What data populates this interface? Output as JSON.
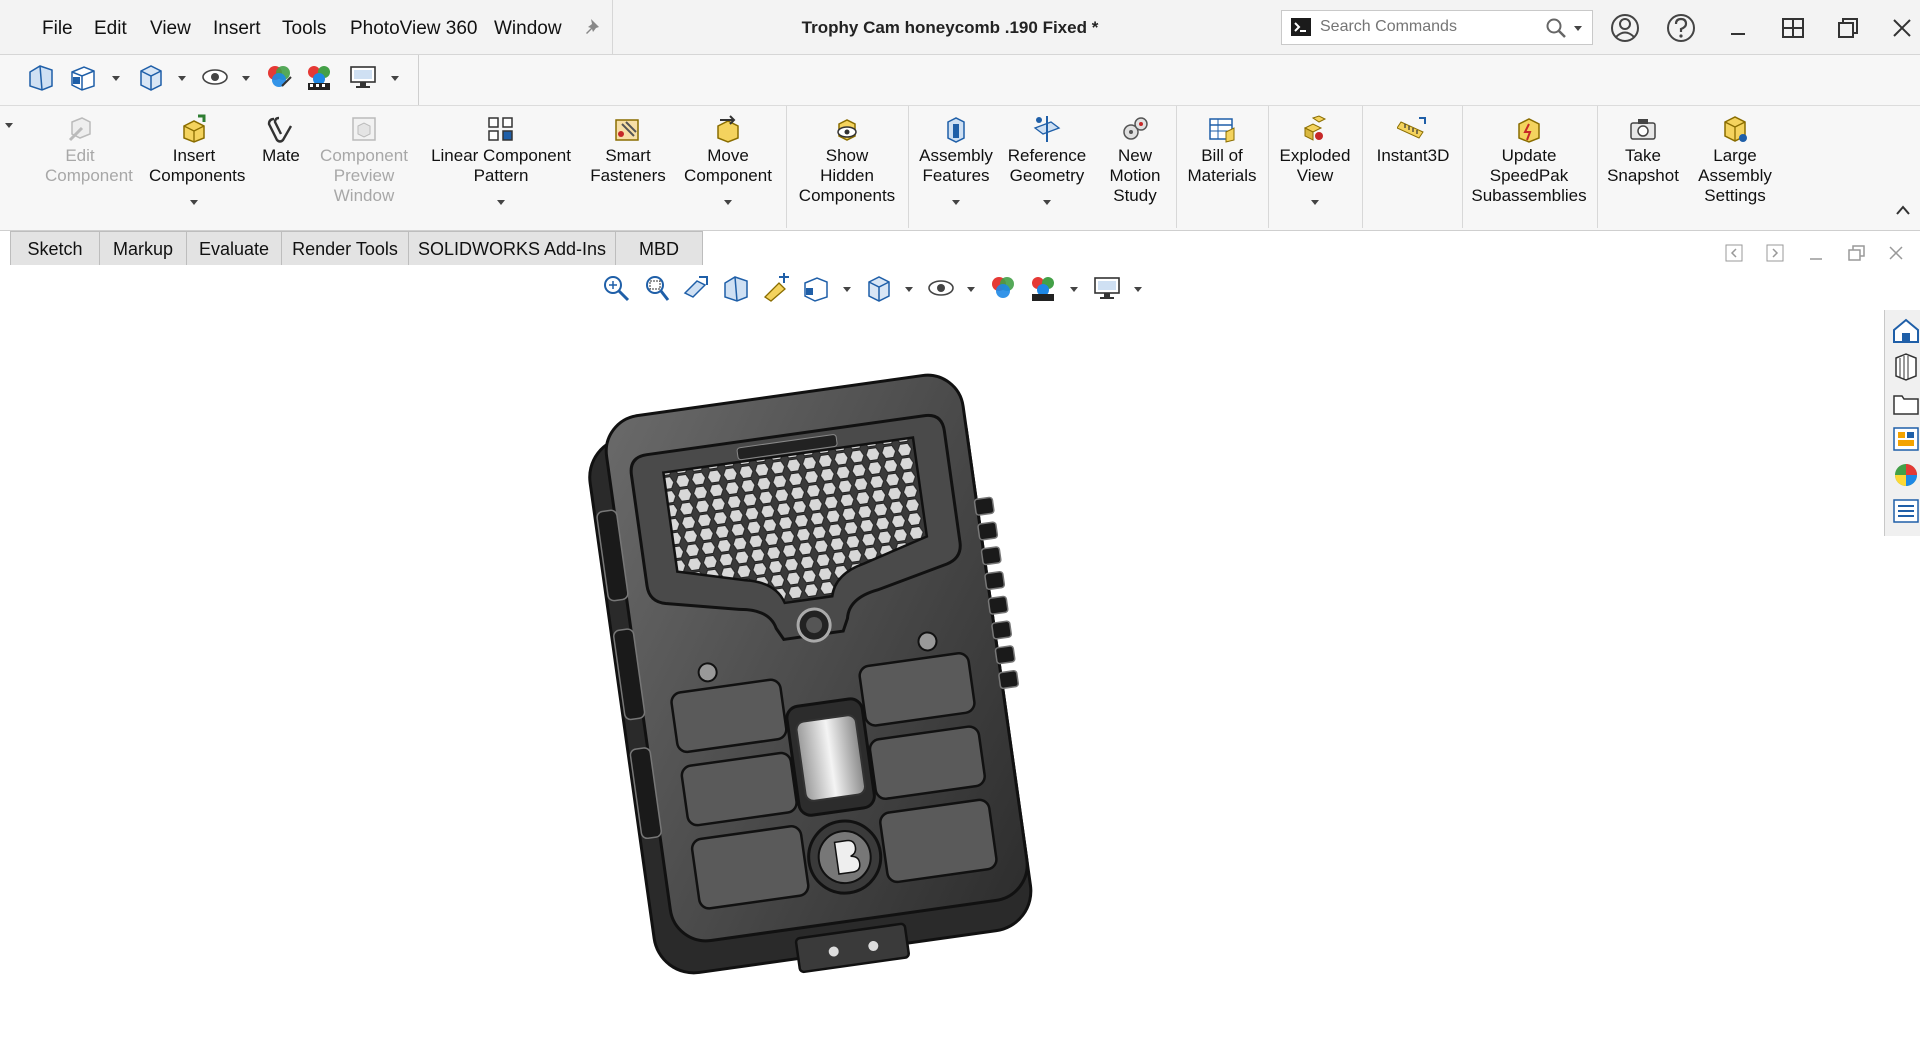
{
  "menu": {
    "file": "File",
    "edit": "Edit",
    "view": "View",
    "insert": "Insert",
    "tools": "Tools",
    "photoview": "PhotoView 360",
    "window": "Window"
  },
  "document_title": "Trophy Cam honeycomb .190 Fixed *",
  "search": {
    "placeholder": "Search Commands"
  },
  "ribbon": {
    "edit_component": "Edit Component",
    "insert_components": "Insert Components",
    "mate": "Mate",
    "component_preview": "Component Preview Window",
    "linear_pattern": "Linear Component Pattern",
    "smart_fasteners": "Smart Fasteners",
    "move_component": "Move Component",
    "show_hidden": "Show Hidden Components",
    "assembly_features": "Assembly Features",
    "reference_geometry": "Reference Geometry",
    "new_motion_study": "New Motion Study",
    "bill_of_materials": "Bill of Materials",
    "exploded_view": "Exploded View",
    "instant3d": "Instant3D",
    "update_speedpak": "Update SpeedPak Subassemblies",
    "take_snapshot": "Take Snapshot",
    "large_assembly": "Large Assembly Settings"
  },
  "tabs": [
    "Sketch",
    "Markup",
    "Evaluate",
    "Render Tools",
    "SOLIDWORKS Add-Ins",
    "MBD"
  ],
  "icons": {
    "accent_blue": "#1f5fa8",
    "disabled_gray": "#a8a8a8"
  }
}
